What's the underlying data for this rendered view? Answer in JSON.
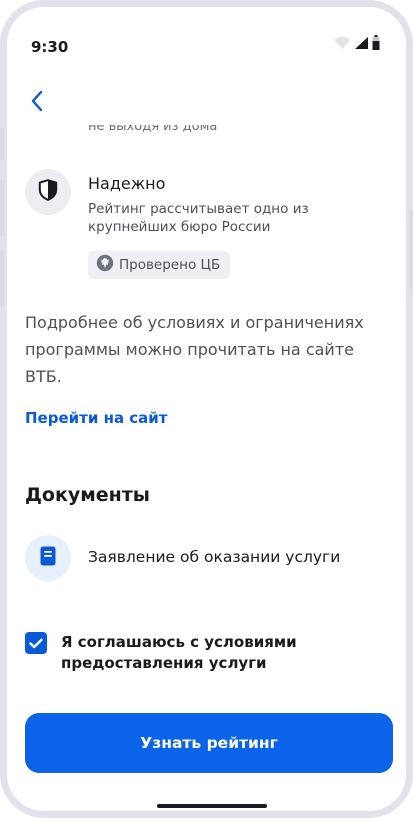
{
  "status_bar": {
    "time": "9:30",
    "icons": [
      "wifi-icon",
      "signal-icon",
      "battery-icon"
    ]
  },
  "nav": {
    "back_icon": "chevron-left-icon"
  },
  "content": {
    "cut_text": "не выходя из дома",
    "feature": {
      "icon": "shield-icon",
      "title": "Надежно",
      "description": "Рейтинг рассчитывает одно из крупнейших бюро России",
      "badge": {
        "icon": "central-bank-emblem-icon",
        "label": "Проверено ЦБ"
      }
    },
    "info_text": "Подробнее об условиях и ограничениях программы можно прочитать на сайте ВТБ.",
    "site_link": "Перейти на сайт",
    "documents": {
      "title": "Документы",
      "items": [
        {
          "icon": "document-icon",
          "label": "Заявление об оказании услуги"
        }
      ]
    },
    "consent": {
      "checked": true,
      "label": "Я соглашаюсь с условиями предоставления услуги"
    }
  },
  "cta": {
    "label": "Узнать рейтинг"
  },
  "colors": {
    "accent": "#0b59d6",
    "button": "#0a63e9",
    "text_primary": "#1b1b1f",
    "text_secondary": "#4d5058",
    "icon_bg": "#eceef3",
    "doc_icon_bg": "#e7f0fd"
  }
}
